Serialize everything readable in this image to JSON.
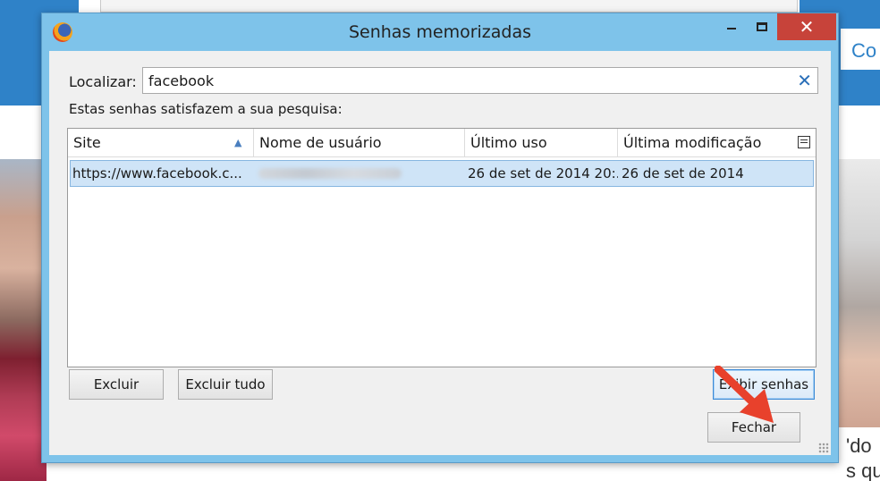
{
  "background": {
    "logo_fragment": "Co",
    "caption_line1": "'do",
    "caption_line2": "s que de"
  },
  "window": {
    "title": "Senhas memorizadas",
    "app_icon": "firefox-icon",
    "controls": {
      "minimize": "minimize-icon",
      "maximize": "maximize-icon",
      "close": "close-icon",
      "close_glyph": "✕"
    }
  },
  "search": {
    "label": "Localizar:",
    "value": "facebook",
    "clear_glyph": "✕"
  },
  "info_text": "Estas senhas satisfazem a sua pesquisa:",
  "table": {
    "columns": [
      "Site",
      "Nome de usuário",
      "Último uso",
      "Última modificação"
    ],
    "sort_glyph": "▲",
    "rows": [
      {
        "site": "https://www.facebook.c...",
        "username": "",
        "last_used": "26 de set de 2014 20:...",
        "last_modified": "26 de set de 2014"
      }
    ]
  },
  "buttons": {
    "delete": "Excluir",
    "delete_all": "Excluir tudo",
    "show_passwords": "Exibir senhas",
    "close": "Fechar"
  },
  "colors": {
    "titlebar": "#7ec3ea",
    "close_button": "#c7433a",
    "selected_row": "#cfe4f7",
    "annotation_arrow": "#e8412c",
    "page_band": "#2f82c8"
  }
}
